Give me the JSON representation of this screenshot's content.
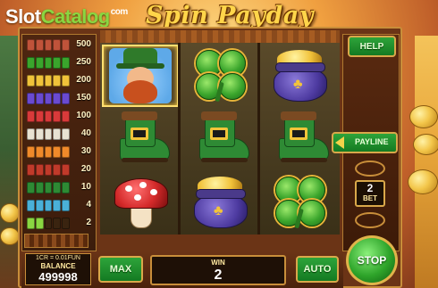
{
  "watermark": {
    "part_a": "Slot",
    "part_b": "Catalog",
    "suffix": "com"
  },
  "game": {
    "title": "Spin Payday"
  },
  "paytable": {
    "rows": [
      {
        "value": "500",
        "colors": [
          "#c0533a",
          "#c0533a",
          "#c0533a",
          "#c0533a",
          "#c0533a"
        ]
      },
      {
        "value": "250",
        "colors": [
          "#3aa52c",
          "#3aa52c",
          "#3aa52c",
          "#3aa52c",
          "#3aa52c"
        ]
      },
      {
        "value": "200",
        "colors": [
          "#f0c23a",
          "#f0c23a",
          "#f0c23a",
          "#f0c23a",
          "#f0c23a"
        ]
      },
      {
        "value": "150",
        "colors": [
          "#6a4ad0",
          "#6a4ad0",
          "#6a4ad0",
          "#6a4ad0",
          "#6a4ad0"
        ]
      },
      {
        "value": "100",
        "colors": [
          "#d83a3a",
          "#d83a3a",
          "#d83a3a",
          "#d83a3a",
          "#d83a3a"
        ]
      },
      {
        "value": "40",
        "colors": [
          "#e8e2d2",
          "#e8e2d2",
          "#e8e2d2",
          "#e8e2d2",
          "#e8e2d2"
        ]
      },
      {
        "value": "30",
        "colors": [
          "#f08a2a",
          "#f08a2a",
          "#f08a2a",
          "#f08a2a",
          "#f08a2a"
        ]
      },
      {
        "value": "20",
        "colors": [
          "#c03a2a",
          "#c03a2a",
          "#c03a2a",
          "#c03a2a",
          "#c03a2a"
        ]
      },
      {
        "value": "10",
        "colors": [
          "#2e8a34",
          "#2e8a34",
          "#2e8a34",
          "#2e8a34",
          "#2e8a34"
        ]
      },
      {
        "value": "4",
        "colors": [
          "#4ab0d8",
          "#4ab0d8",
          "#4ab0d8",
          "#4ab0d8",
          "#4ab0d8"
        ]
      },
      {
        "value": "2",
        "colors": [
          "#8ad641",
          "#8ad641",
          "#3a2410",
          "#3a2410",
          "#3a2410"
        ]
      }
    ]
  },
  "reels": [
    [
      "leprechaun",
      "boot",
      "mushroom"
    ],
    [
      "clover",
      "boot",
      "pot"
    ],
    [
      "pot",
      "boot",
      "clover"
    ]
  ],
  "controls": {
    "help_label": "HELP",
    "payline_label": "PAYLINE",
    "bet_value": "2",
    "bet_label": "BET",
    "stop_label": "STOP",
    "max_label": "MAX",
    "auto_label": "AUTO"
  },
  "info": {
    "cr_text": "1CR = 0.01FUN",
    "balance_label": "BALANCE",
    "balance_value": "499998",
    "win_label": "WIN",
    "win_value": "2"
  }
}
